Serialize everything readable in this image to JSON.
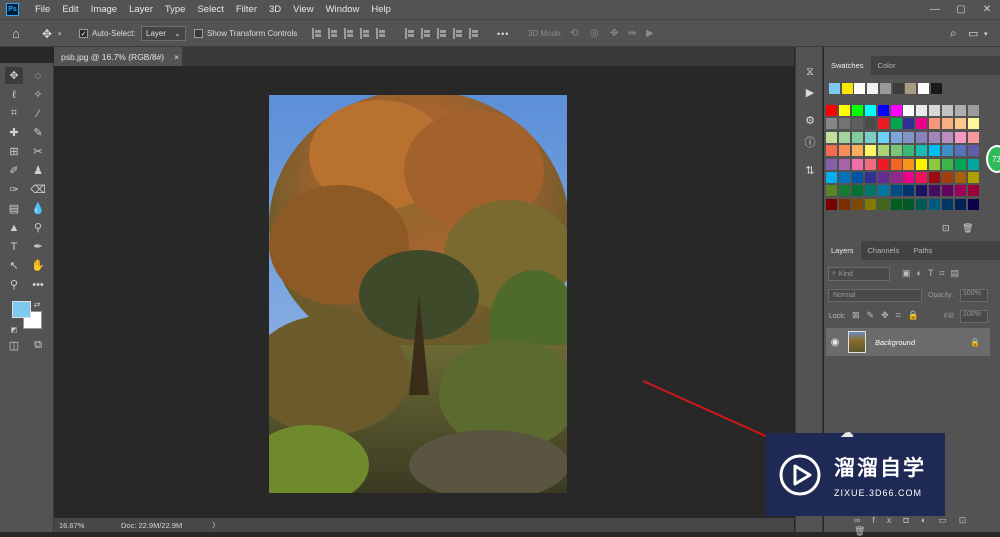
{
  "app": {
    "logo": "Ps"
  },
  "menu": [
    "File",
    "Edit",
    "Image",
    "Layer",
    "Type",
    "Select",
    "Filter",
    "3D",
    "View",
    "Window",
    "Help"
  ],
  "window_controls": {
    "minimize": "—",
    "maximize": "▢",
    "close": "✕"
  },
  "options": {
    "auto_select_label": "Auto-Select:",
    "auto_select_value": "Layer",
    "show_transform_label": "Show Transform Controls",
    "more": "•••",
    "mode_3d_label": "3D Mode:"
  },
  "document_tab": {
    "title": "psb.jpg @ 16.7% (RGB/8#)",
    "close": "×"
  },
  "status": {
    "zoom": "16.67%",
    "doc": "Doc: 22.9M/22.9M",
    "arrow": "〉"
  },
  "swatches_panel": {
    "tabs": [
      "Swatches",
      "Color"
    ],
    "recent": [
      "#7dc9f0",
      "#f6e600",
      "#ffffff",
      "#f2f2f2",
      "#9a9a9a",
      "#3c3c3c",
      "#a79b83",
      "#ffffff",
      "#1a1a1a"
    ],
    "grid": [
      [
        "#ff0000",
        "#ffff00",
        "#00ff00",
        "#00ffff",
        "#0000ff",
        "#ff00ff",
        "#ffffff",
        "#ebebeb",
        "#d7d7d7",
        "#c3c3c3",
        "#afafaf",
        "#9b9b9b"
      ],
      [
        "#878787",
        "#737373",
        "#5f5f5f",
        "#4b4b4b",
        "#ed1c24",
        "#00a650",
        "#2e3192",
        "#ec008c",
        "#f7977a",
        "#f9ad81",
        "#fdc68a",
        "#fff79a"
      ],
      [
        "#c4df9b",
        "#a3d39c",
        "#82ca9d",
        "#7bcdc8",
        "#6ecff6",
        "#7ea7d8",
        "#8493ca",
        "#8882be",
        "#a187be",
        "#bc8dbf",
        "#f49ac2",
        "#f6989d"
      ],
      [
        "#f26c4f",
        "#f68e56",
        "#fbaf5d",
        "#fff568",
        "#acd372",
        "#7cc576",
        "#3bb878",
        "#1abbb4",
        "#00bff3",
        "#438ccb",
        "#5574b9",
        "#605ca8"
      ],
      [
        "#855fa8",
        "#a763a8",
        "#f06eaa",
        "#f26d7d",
        "#ed1c24",
        "#f26522",
        "#f7941d",
        "#fff200",
        "#8dc73f",
        "#39b54a",
        "#00a651",
        "#00a99d"
      ],
      [
        "#00aeef",
        "#0072bc",
        "#0054a6",
        "#2e3192",
        "#662d91",
        "#92278f",
        "#ec008c",
        "#ed145b",
        "#9e0b0f",
        "#a0410d",
        "#a36209",
        "#aba000"
      ],
      [
        "#598527",
        "#197b30",
        "#007236",
        "#00746b",
        "#0076a3",
        "#004b80",
        "#003471",
        "#1b1464",
        "#440e62",
        "#630460",
        "#9e005d",
        "#9e0039"
      ],
      [
        "#790000",
        "#7b2e00",
        "#7d4900",
        "#827b00",
        "#406618",
        "#005e20",
        "#005826",
        "#005952",
        "#005b7f",
        "#003663",
        "#002157",
        "#0d004c"
      ]
    ]
  },
  "layers_panel": {
    "tabs": [
      "Layers",
      "Channels",
      "Paths"
    ],
    "kind_label": "Kind",
    "blend_mode": "Normal",
    "opacity_label": "Opacity:",
    "opacity_value": "100%",
    "lock_label": "Lock:",
    "fill_label": "Fill:",
    "fill_value": "100%",
    "layers": [
      {
        "name": "Background",
        "visible": true,
        "locked": true
      }
    ]
  },
  "watermark": {
    "main": "溜溜自学",
    "sub": "ZIXUE.3D66.COM"
  },
  "badge": {
    "text": "73"
  }
}
